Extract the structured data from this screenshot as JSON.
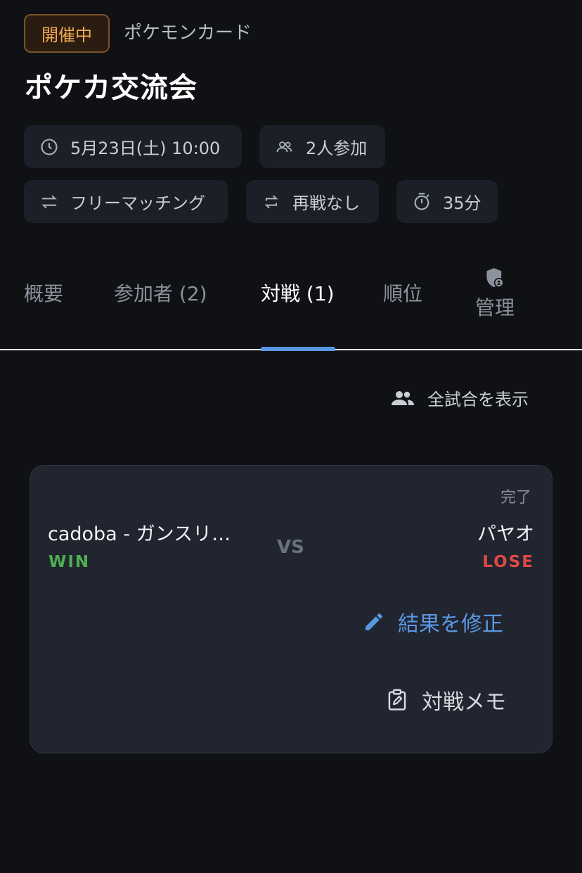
{
  "event": {
    "status": "開催中",
    "category": "ポケモンカード",
    "title": "ポケカ交流会"
  },
  "chips": {
    "datetime": "5月23日(土) 10:00",
    "participants": "2人参加",
    "matching": "フリーマッチング",
    "rematch": "再戦なし",
    "duration": "35分"
  },
  "tabs": {
    "overview": "概要",
    "participants": "参加者 (2)",
    "matches": "対戦 (1)",
    "ranking": "順位",
    "admin": "管理",
    "active": "matches"
  },
  "matches_view": {
    "show_all": "全試合を表示"
  },
  "match": {
    "status": "完了",
    "player1": {
      "name": "cadoba - ガンスリ…",
      "result": "WIN"
    },
    "vs": "VS",
    "player2": {
      "name": "パヤオ",
      "result": "LOSE"
    },
    "edit_result": "結果を修正",
    "memo": "対戦メモ"
  },
  "colors": {
    "background": "#0f1115",
    "accent": "#5a97e2",
    "status_badge": "#f3a951",
    "win": "#4caf50",
    "lose": "#e04848"
  },
  "icons": {
    "datetime": "clock-icon",
    "participants": "people-icon",
    "matching": "swap-arrows-icon",
    "rematch": "repeat-icon",
    "duration": "timer-icon",
    "admin": "shield-user-icon",
    "show_all": "group-icon",
    "edit": "pencil-icon",
    "memo": "clipboard-edit-icon"
  }
}
